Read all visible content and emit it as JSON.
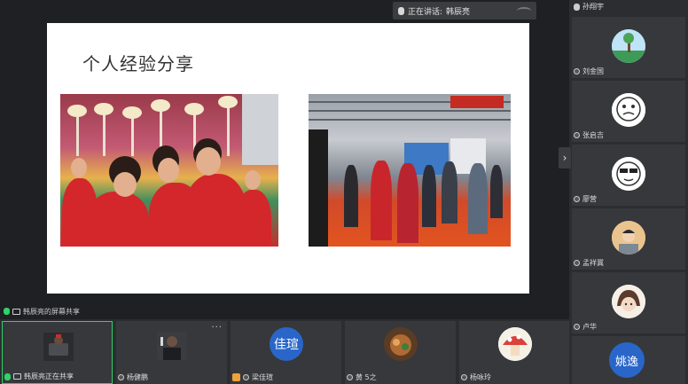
{
  "speaker_bar": {
    "label": "正在讲话:",
    "name": "韩辰亮"
  },
  "slide": {
    "title": "个人经验分享"
  },
  "share_status": {
    "text": "韩辰亮的屏幕共享"
  },
  "side_participants": [
    {
      "name": "孙翔宇"
    },
    {
      "name": "刘金国"
    },
    {
      "name": "张启吉"
    },
    {
      "name": "廖营"
    },
    {
      "name": "孟祥冀"
    },
    {
      "name": "卢华"
    }
  ],
  "side_avatar_text": "姚逸",
  "bottom_participants": [
    {
      "name": "韩辰亮正在共享"
    },
    {
      "name": "杨健鹏"
    },
    {
      "name": "梁佳瑄",
      "avatar_text": "佳瑄"
    },
    {
      "name": "黄 5之"
    },
    {
      "name": "杨咏玲"
    }
  ],
  "colors": {
    "accent_green": "#2fd36a",
    "avatar_blue": "#2a66c9",
    "avatar_yaoyi": "#2a66c9"
  }
}
